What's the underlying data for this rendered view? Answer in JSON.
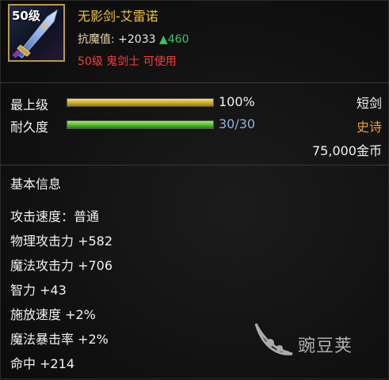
{
  "header": {
    "icon_level": "50级",
    "item_name": "无影剑-艾雷诺",
    "defense_label": "抗魔值:",
    "defense_value": "+2033",
    "defense_up": "▲460",
    "requirement": "50级 鬼剑士 可使用"
  },
  "stats": {
    "grade": {
      "label": "最上级",
      "value_text": "100%",
      "fill": 1.0
    },
    "durability": {
      "label": "耐久度",
      "value_text": "30/30",
      "fill": 1.0
    }
  },
  "meta": {
    "type": "短剑",
    "rarity": "史诗",
    "price": "75,000金币"
  },
  "colors": {
    "item_name": "#f0c33c",
    "rarity": "#e8a12a",
    "requirement": "#ff3b3b",
    "increase": "#3ec25a"
  },
  "info": {
    "title": "基本信息",
    "attributes": [
      "攻击速度：普通",
      "物理攻击力 +582",
      "魔法攻击力 +706",
      "智力 +43",
      "施放速度 +2%",
      "魔法暴击率 +2%",
      "命中 +214"
    ]
  },
  "watermark": {
    "text": "豌豆荚",
    "icon": "pea-pod-logo-icon"
  }
}
